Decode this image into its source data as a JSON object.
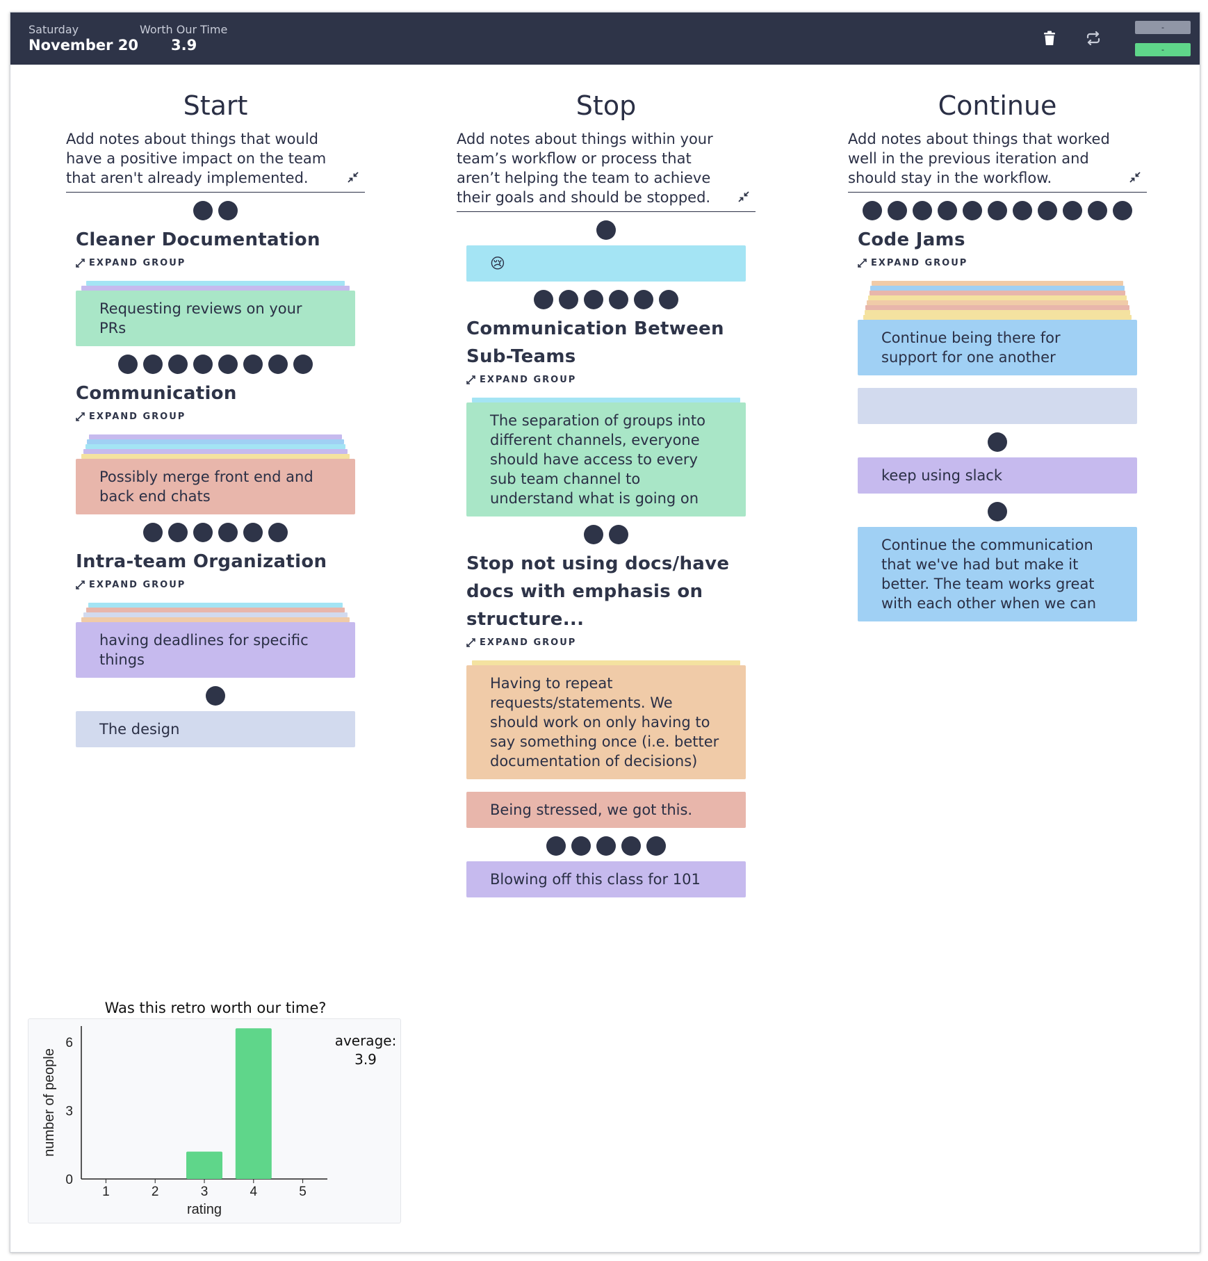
{
  "header": {
    "day": "Saturday",
    "date": "November 20",
    "worth_label": "Worth Our Time",
    "worth_value": "3.9",
    "icons": [
      "trash-icon",
      "repeat-icon"
    ],
    "button_top": "-",
    "button_bottom": "-",
    "colors": {
      "bar": "#2e3448",
      "button_top": "#9096a6",
      "button_bottom": "#5fd68a"
    }
  },
  "columns": [
    {
      "title": "Start",
      "description": "Add notes about things that would have a positive impact on the team that aren't already implemented.",
      "items": [
        {
          "type": "group",
          "votes": 2,
          "title": "Cleaner Documentation",
          "expand_label": "EXPAND GROUP",
          "stack": [
            "cyan",
            "purple"
          ],
          "card": {
            "text": "Requesting reviews on your PRs",
            "color": "green"
          }
        },
        {
          "type": "group",
          "votes": 8,
          "title": "Communication",
          "expand_label": "EXPAND GROUP",
          "stack": [
            "purple",
            "blue",
            "cyan",
            "purple",
            "yellow"
          ],
          "card": {
            "text": "Possibly merge front end and back end chats",
            "color": "red"
          }
        },
        {
          "type": "group",
          "votes": 6,
          "title": "Intra-team Organization",
          "expand_label": "EXPAND GROUP",
          "stack": [
            "cyan",
            "red",
            "gray",
            "orange"
          ],
          "card": {
            "text": "having deadlines for specific things",
            "color": "purple"
          }
        },
        {
          "type": "note",
          "votes": 1,
          "text": "The design",
          "color": "gray"
        }
      ]
    },
    {
      "title": "Stop",
      "description": "Add notes about things within your team’s workflow or process that aren’t helping the team to achieve their goals and should be stopped.",
      "items": [
        {
          "type": "note",
          "votes": 1,
          "text": "😢",
          "color": "cyan"
        },
        {
          "type": "group",
          "votes": 6,
          "title": "Communication Between Sub-Teams",
          "expand_label": "EXPAND GROUP",
          "stack": [
            "cyan"
          ],
          "card": {
            "text": "The separation of groups into different channels, everyone should have access to every sub team channel to understand what is going on",
            "color": "green"
          }
        },
        {
          "type": "group",
          "votes": 2,
          "title": "Stop not using docs/have docs with emphasis on structure...",
          "expand_label": "EXPAND GROUP",
          "stack": [
            "yellow"
          ],
          "card": {
            "text": "Having to repeat requests/statements. We should work on only having to say something once (i.e. better documentation of decisions)",
            "color": "orange"
          }
        },
        {
          "type": "note",
          "votes": 0,
          "text": "Being stressed, we got this.",
          "color": "red"
        },
        {
          "type": "note",
          "votes": 5,
          "text": "Blowing off this class for 101",
          "color": "purple"
        }
      ]
    },
    {
      "title": "Continue",
      "description": "Add notes about things that worked well in the previous iteration and should stay in the workflow.",
      "items": [
        {
          "type": "group",
          "votes": 11,
          "title": "Code Jams",
          "expand_label": "EXPAND GROUP",
          "stack": [
            "orange",
            "blue",
            "red",
            "yellow",
            "orange",
            "red",
            "yellow",
            "yellow"
          ],
          "card": {
            "text": "Continue being there for support for one another",
            "color": "blue"
          }
        },
        {
          "type": "note",
          "votes": 0,
          "text": "",
          "color": "gray"
        },
        {
          "type": "note",
          "votes": 1,
          "text": "keep using slack",
          "color": "purple"
        },
        {
          "type": "note",
          "votes": 1,
          "text": "Continue the communication that we've had but make it better. The team works great with each other when we can",
          "color": "blue"
        }
      ]
    }
  ],
  "note_colors": {
    "green": "#a9e6c7",
    "blue": "#a0d0f4",
    "cyan": "#a4e4f4",
    "purple": "#c6baee",
    "red": "#e8b6ab",
    "orange": "#f0cba8",
    "yellow": "#f4e2a0",
    "gray": "#d2daee"
  },
  "chart_title": "Was this retro worth our time?",
  "chart_data": {
    "type": "bar",
    "title": "Was this retro worth our time?",
    "categories": [
      "1",
      "2",
      "3",
      "4",
      "5"
    ],
    "values": [
      0,
      0,
      1.2,
      6.6,
      0
    ],
    "xlabel": "rating",
    "ylabel": "number of people",
    "yticks": [
      "0",
      "3",
      "6"
    ],
    "ylim": [
      0,
      6.7
    ],
    "bar_color": "#5fd68a",
    "annotation": {
      "label": "average:",
      "value": "3.9"
    }
  }
}
